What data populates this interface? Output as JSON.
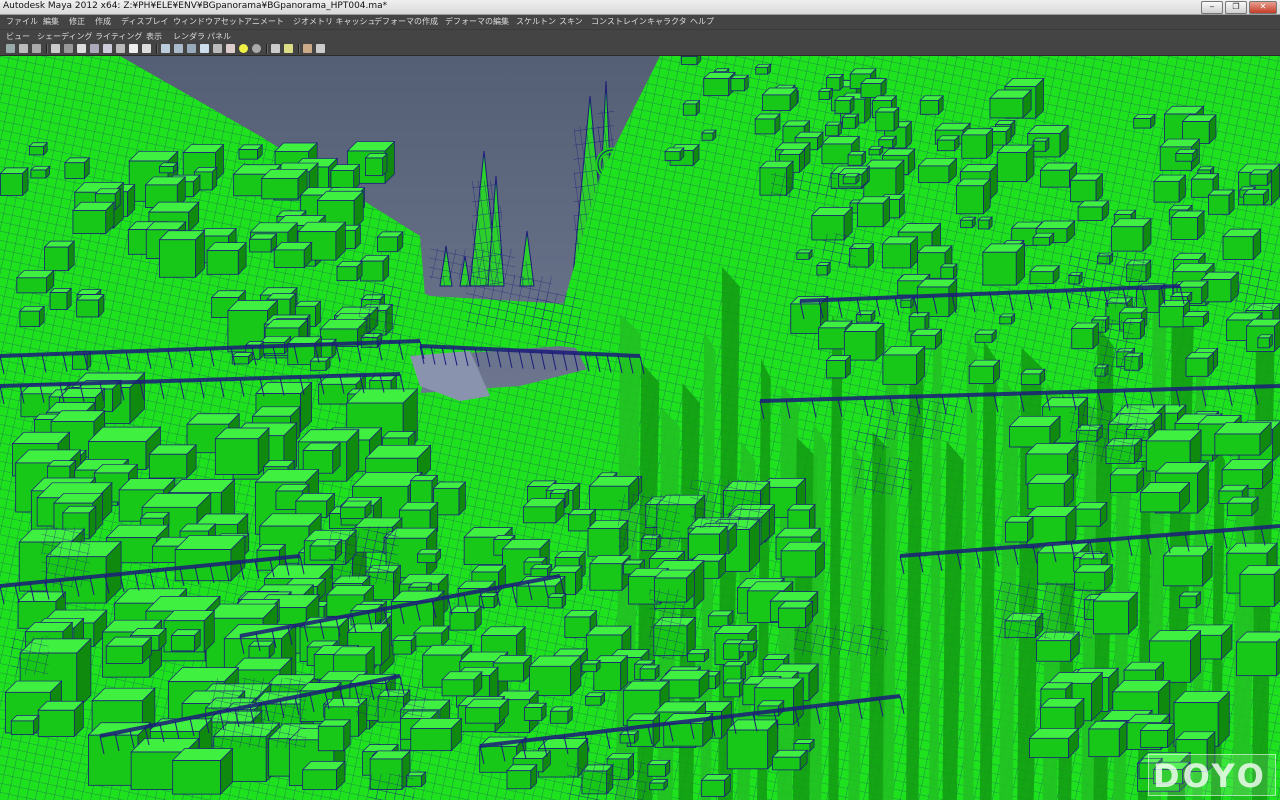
{
  "window": {
    "title": "Autodesk Maya 2012 x64: Z:¥PH¥ELE¥ENV¥BGpanorama¥BGpanorama_HPT004.ma*"
  },
  "main_menu": [
    "ファイル",
    "編集",
    "修正",
    "作成",
    "ディスプレイ",
    "ウィンドウ",
    "アセット",
    "アニメート",
    "ジオメトリ キャッシュ",
    "デフォーマの作成",
    "デフォーマの編集",
    "スケルトン",
    "スキン",
    "コンストレイン",
    "キャラクタ",
    "ヘルプ"
  ],
  "panel_menu": [
    "ビュー",
    "シェーディング",
    "ライティング",
    "表示",
    "レンダラ",
    "パネル"
  ],
  "toolbar_icons": [
    "select-camera-icon",
    "camera-attributes-icon",
    "bookmark-icon",
    "image-plane-icon",
    "grid-icon",
    "film-gate-icon",
    "resolution-gate-icon",
    "gate-mask-icon",
    "field-chart-icon",
    "safe-action-icon",
    "safe-title-icon",
    "wireframe-icon",
    "smooth-shade-icon",
    "smooth-shade-all-icon",
    "flat-shade-icon",
    "bounding-box-icon",
    "textured-icon",
    "use-lights-icon",
    "shadows-icon",
    "isolate-select-icon",
    "xray-icon",
    "xray-joints-icon",
    "xray-components-icon"
  ],
  "colors": {
    "mesh_green": "#1ee21e",
    "wire_blue": "#1c1c7a",
    "sky_top": "#545e74",
    "sky_bottom": "#8a93ad"
  },
  "watermark": {
    "text": "DOYO"
  }
}
